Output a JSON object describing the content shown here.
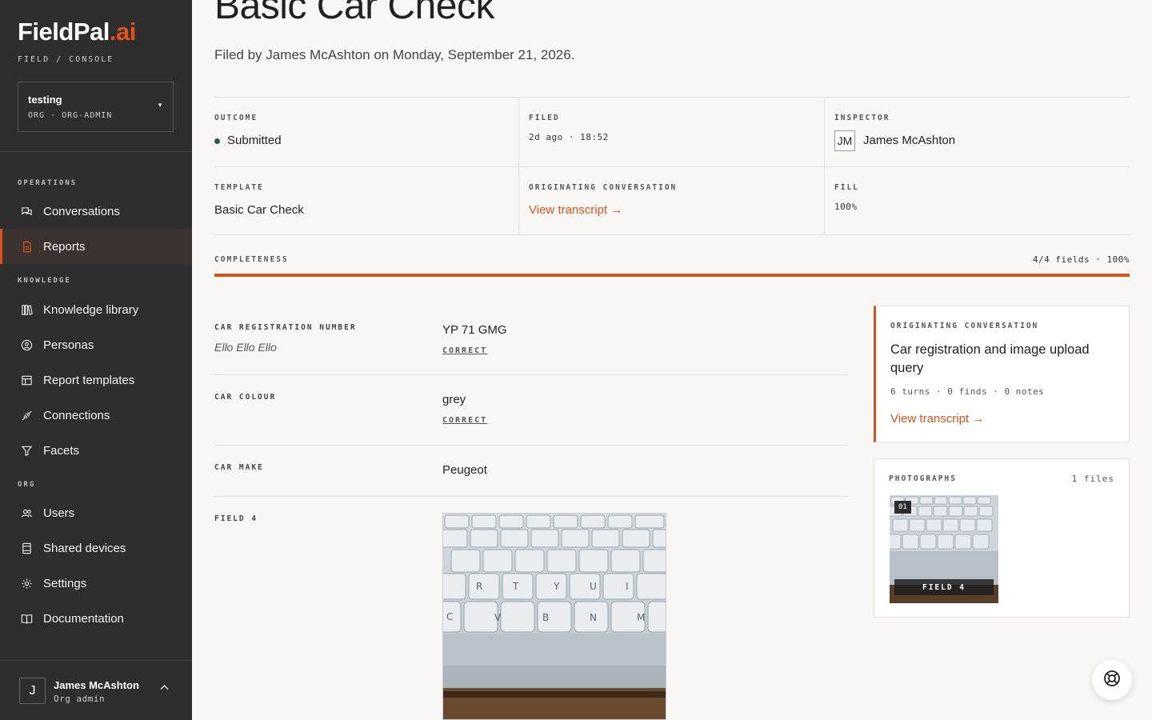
{
  "sidebar": {
    "logo_main": "FieldPal",
    "logo_accent": ".ai",
    "logo_sub": "FIELD / CONSOLE",
    "org": {
      "name": "testing",
      "role": "ORG · ORG-ADMIN"
    },
    "sections": {
      "operations": "OPERATIONS",
      "knowledge": "KNOWLEDGE",
      "org": "ORG"
    },
    "items": [
      {
        "label": "Conversations",
        "icon": "chat-icon"
      },
      {
        "label": "Reports",
        "icon": "document-icon",
        "active": true
      },
      {
        "label": "Knowledge library",
        "icon": "library-icon"
      },
      {
        "label": "Personas",
        "icon": "persona-icon"
      },
      {
        "label": "Report templates",
        "icon": "template-icon"
      },
      {
        "label": "Connections",
        "icon": "plug-icon"
      },
      {
        "label": "Facets",
        "icon": "filter-icon"
      },
      {
        "label": "Users",
        "icon": "users-icon"
      },
      {
        "label": "Shared devices",
        "icon": "device-icon"
      },
      {
        "label": "Settings",
        "icon": "gear-icon"
      },
      {
        "label": "Documentation",
        "icon": "book-icon"
      }
    ],
    "user": {
      "initial": "J",
      "name": "James McAshton",
      "role": "Org admin"
    }
  },
  "header": {
    "title": "Basic Car Check",
    "subtitle": "Filed by James McAshton on Monday, September 21, 2026."
  },
  "meta": {
    "outcome_label": "OUTCOME",
    "outcome_value": "Submitted",
    "filed_label": "FILED",
    "filed_value": "2d ago · 18:52",
    "inspector_label": "INSPECTOR",
    "inspector_initials": "JM",
    "inspector_name": "James McAshton",
    "template_label": "TEMPLATE",
    "template_value": "Basic Car Check",
    "conversation_label": "ORIGINATING CONVERSATION",
    "conversation_link": "View transcript →",
    "fill_label": "FILL",
    "fill_value": "100%"
  },
  "completeness": {
    "label": "COMPLETENESS",
    "value": "4/4 fields · 100%",
    "fraction": 1.0
  },
  "fields": [
    {
      "label": "CAR REGISTRATION NUMBER",
      "hint": "Ello Ello Ello",
      "value": "YP 71 GMG",
      "tag": "CORRECT"
    },
    {
      "label": "CAR COLOUR",
      "value": "grey",
      "tag": "CORRECT"
    },
    {
      "label": "CAR MAKE",
      "value": "Peugeot"
    },
    {
      "label": "FIELD 4"
    }
  ],
  "conversation_card": {
    "label": "ORIGINATING CONVERSATION",
    "title": "Car registration and image upload query",
    "stats": "6 turns · 0 finds · 0 notes",
    "link": "View transcript →"
  },
  "photos_card": {
    "label": "PHOTOGRAPHS",
    "count": "1 files",
    "badge": "01",
    "caption": "FIELD 4"
  },
  "colors": {
    "accent": "#d4531b",
    "sidebar": "#2e2e2e",
    "status_green": "#2f5d3f"
  }
}
